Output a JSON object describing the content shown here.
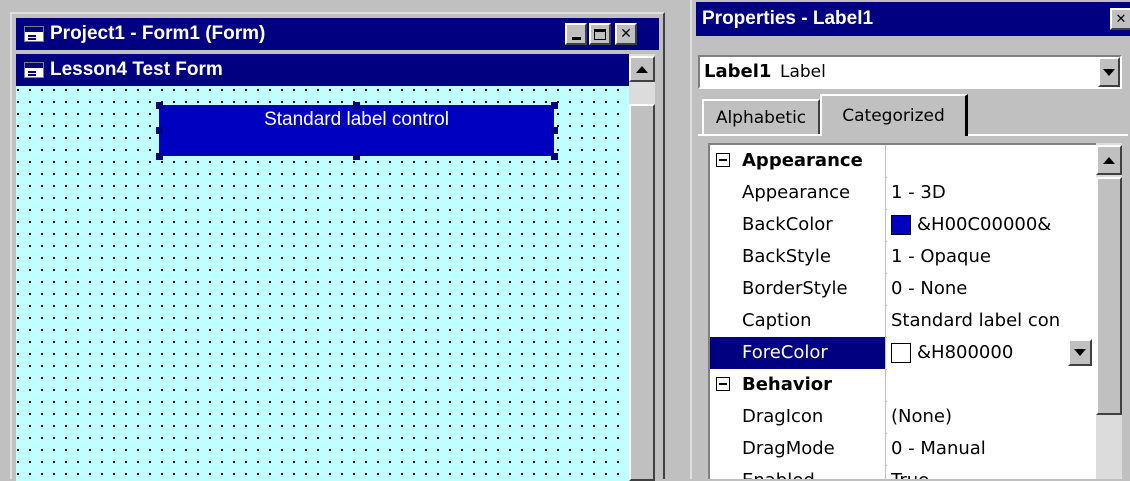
{
  "form_window": {
    "title": "Project1 - Form1 (Form)",
    "inner_title": "Lesson4 Test Form",
    "label_control_text": "Standard label control",
    "buttons": {
      "minimize": "_",
      "maximize": "□",
      "close": "✕"
    }
  },
  "properties_window": {
    "title": "Properties - Label1",
    "close_glyph": "✕",
    "object_name": "Label1",
    "object_type": "Label",
    "tabs": [
      "Alphabetic",
      "Categorized"
    ],
    "active_tab": "Categorized",
    "categories": {
      "appearance": "Appearance",
      "behavior": "Behavior"
    },
    "rows": [
      {
        "name": "Appearance",
        "value": "1 - 3D"
      },
      {
        "name": "BackColor",
        "value": "&H00C00000&",
        "swatch": "#0000c0"
      },
      {
        "name": "BackStyle",
        "value": "1 - Opaque"
      },
      {
        "name": "BorderStyle",
        "value": "0 - None"
      },
      {
        "name": "Caption",
        "value": "Standard label con"
      },
      {
        "name": "ForeColor",
        "value": "&H800000",
        "swatch": "#ffffff",
        "selected": true
      },
      {
        "name": "DragIcon",
        "value": "(None)"
      },
      {
        "name": "DragMode",
        "value": "0 - Manual"
      },
      {
        "name": "Enabled",
        "value": "True"
      }
    ]
  },
  "colors": {
    "titlebar": "#000080",
    "form_background": "#c0ffff",
    "label_background": "#0000c0",
    "selected_row": "#000080"
  }
}
